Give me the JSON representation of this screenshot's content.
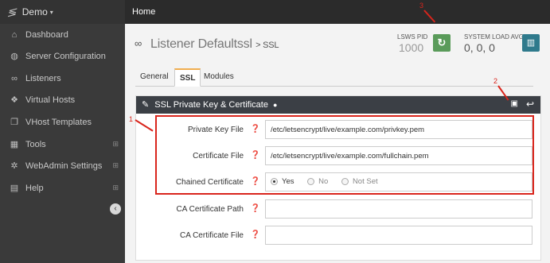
{
  "brand": {
    "name": "Demo"
  },
  "topbar": {
    "title": "Home"
  },
  "sidebar": {
    "items": [
      {
        "label": "Dashboard"
      },
      {
        "label": "Server Configuration"
      },
      {
        "label": "Listeners"
      },
      {
        "label": "Virtual Hosts"
      },
      {
        "label": "VHost Templates"
      },
      {
        "label": "Tools"
      },
      {
        "label": "WebAdmin Settings"
      },
      {
        "label": "Help"
      }
    ]
  },
  "header": {
    "title": "Listener Defaultssl",
    "subtitle": "> SSL",
    "pid_label": "LSWS PID",
    "pid_value": "1000",
    "load_label": "SYSTEM LOAD AVG",
    "load_value": "0, 0, 0"
  },
  "tabs": [
    {
      "label": "General"
    },
    {
      "label": "SSL"
    },
    {
      "label": "Modules"
    }
  ],
  "panel": {
    "title": "SSL Private Key & Certificate",
    "rows": [
      {
        "label": "Private Key File",
        "value": "/etc/letsencrypt/live/example.com/privkey.pem"
      },
      {
        "label": "Certificate File",
        "value": "/etc/letsencrypt/live/example.com/fullchain.pem"
      },
      {
        "label": "Chained Certificate",
        "options": [
          "Yes",
          "No",
          "Not Set"
        ],
        "selected": "Yes"
      },
      {
        "label": "CA Certificate Path",
        "value": ""
      },
      {
        "label": "CA Certificate File",
        "value": ""
      }
    ]
  },
  "annotations": [
    "1",
    "2",
    "3"
  ],
  "colors": {
    "highlight": "#d9251c",
    "restart": "#5a9b5a",
    "chart": "#2f7a8c",
    "tab_active": "#f0ad4e"
  }
}
